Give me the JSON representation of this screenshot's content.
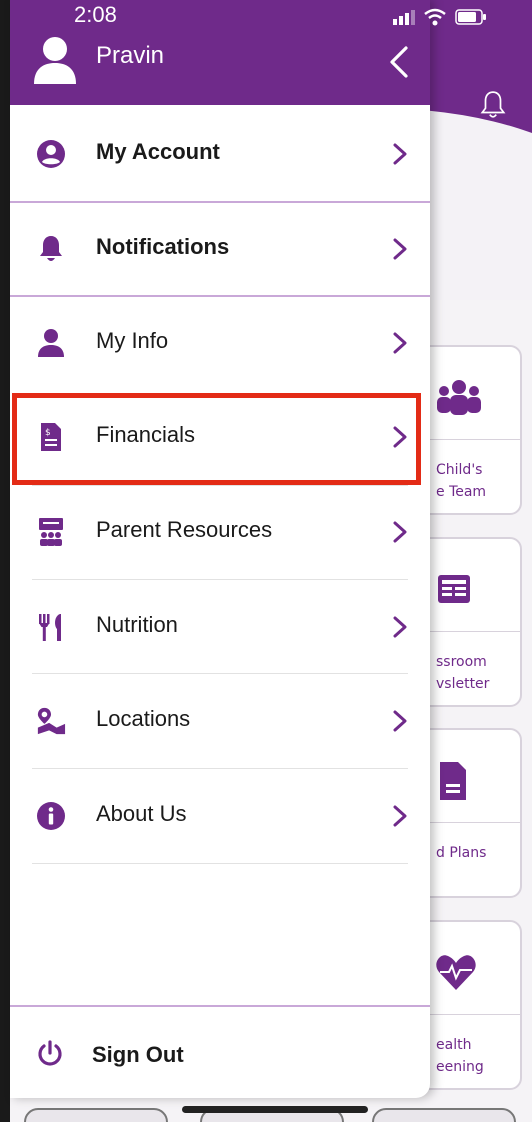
{
  "status_bar": {
    "time": "2:08"
  },
  "drawer": {
    "user_name": "Pravin",
    "menu": [
      {
        "label": "My Account",
        "icon": "account-circle-icon",
        "bold": true
      },
      {
        "label": "Notifications",
        "icon": "bell-icon",
        "bold": true
      },
      {
        "label": "My Info",
        "icon": "person-icon",
        "bold": false
      },
      {
        "label": "Financials",
        "icon": "invoice-document-icon",
        "bold": false,
        "highlighted": true
      },
      {
        "label": "Parent Resources",
        "icon": "presentation-group-icon",
        "bold": false
      },
      {
        "label": "Nutrition",
        "icon": "fork-knife-icon",
        "bold": false
      },
      {
        "label": "Locations",
        "icon": "map-location-icon",
        "bold": false
      },
      {
        "label": "About Us",
        "icon": "info-circle-icon",
        "bold": false
      }
    ],
    "sign_out_label": "Sign Out"
  },
  "background_cards": [
    {
      "line1": "Child's",
      "line2": "e Team",
      "icon": "family-group-icon"
    },
    {
      "line1": "ssroom",
      "line2": "vsletter",
      "icon": "newsletter-icon"
    },
    {
      "line1": "d Plans",
      "line2": "",
      "icon": "document-icon"
    },
    {
      "line1": "ealth",
      "line2": "eening",
      "icon": "heart-pulse-icon"
    }
  ],
  "colors": {
    "brand_purple": "#6f2a8a",
    "highlight_red": "#e32b16",
    "divider_lilac": "#c9a8d8"
  }
}
